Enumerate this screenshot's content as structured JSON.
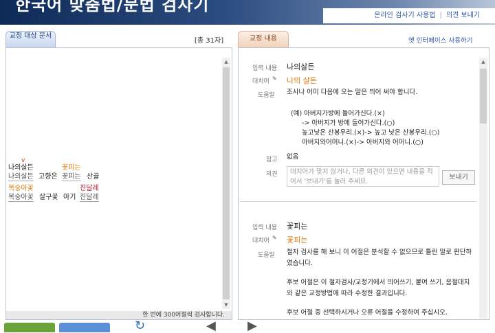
{
  "header": {
    "title": "한국어 맞춤법/문법 검사기",
    "links": [
      "온라인 검사기 사용법",
      "의견 보내기"
    ]
  },
  "left": {
    "tab_label": "교정 대상 문서",
    "char_count": "[총 31자]",
    "footer_note": "한 번에 300어절씩 검사합니다.",
    "line1_orig": [
      "나의살든",
      "꽃피는"
    ],
    "line1_under": [
      "나의살든",
      "고향은",
      "꽃피는",
      "산골"
    ],
    "line2_orig": [
      "복숭아꽃",
      "진달레"
    ],
    "line2_under": [
      "복숭아꽃",
      "살구꽃",
      "아기",
      "진달레"
    ]
  },
  "right": {
    "tab_label": "교정 내용",
    "old_interface_link": "옛 인터페이스 사용하기",
    "labels": {
      "input": "입력 내용",
      "alt": "대치어",
      "help": "도움말",
      "ref": "참고",
      "opinion": "의견"
    },
    "entry1": {
      "input": "나의살든",
      "alt": "나의 살든",
      "help": "조사나 어미 다음에 오는 말은 띄어 써야 합니다.",
      "examples": [
        "(예) 아버지가방에 들어가신다.(×)",
        "-> 아버지가 방에 들어가신다.(○)",
        "높고낮은 산봉우리.(×)-> 높고 낮은 산봉우리.(○)",
        "아버지와어머니.(×)-> 아버지와 어머니.(○)"
      ],
      "ref": "없음",
      "opinion_placeholder": "대치어가 맞지 않거나, 다른 의견이 있으면 내용을 적어서 '보내기'를 눌러 주세요.",
      "send_label": "보내기"
    },
    "entry2": {
      "input": "꽃피는",
      "alt": "꽃피는",
      "help_lines": [
        "철자 검사를 해 보니 이 어절은 분석할 수 없으므로 틀린 말로 판단하였습니다.",
        "",
        "후보 어절은 이 철자검사/교정기에서 띄어쓰기, 붙여 쓰기, 음절대치와 같은 교정방법에 따라 수정한 결과입니다.",
        "",
        "후보 어절 중 선택하시거나 오류 어절을 수정하여 주십시오."
      ]
    }
  }
}
